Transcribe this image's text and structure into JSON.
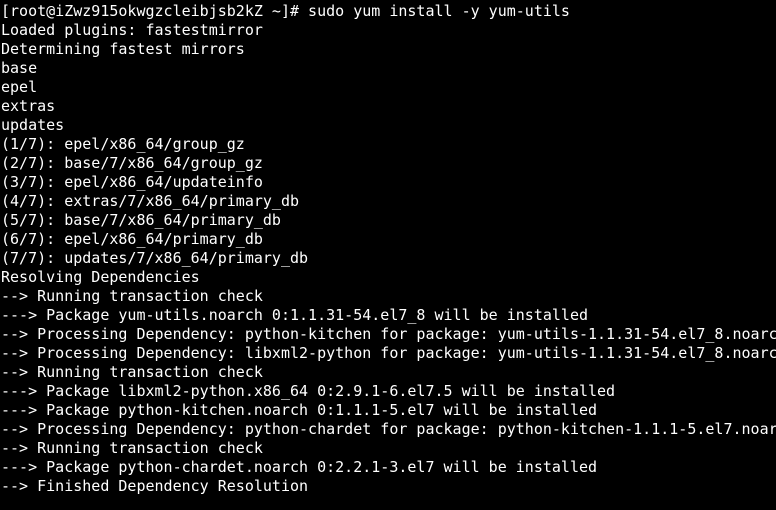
{
  "terminal": {
    "colors": {
      "background": "#000000",
      "foreground": "#ffffff"
    },
    "lines": [
      "[root@iZwz915okwgzcleibjsb2kZ ~]# sudo yum install -y yum-utils",
      "Loaded plugins: fastestmirror",
      "Determining fastest mirrors",
      "base",
      "epel",
      "extras",
      "updates",
      "(1/7): epel/x86_64/group_gz",
      "(2/7): base/7/x86_64/group_gz",
      "(3/7): epel/x86_64/updateinfo",
      "(4/7): extras/7/x86_64/primary_db",
      "(5/7): base/7/x86_64/primary_db",
      "(6/7): epel/x86_64/primary_db",
      "(7/7): updates/7/x86_64/primary_db",
      "Resolving Dependencies",
      "--> Running transaction check",
      "---> Package yum-utils.noarch 0:1.1.31-54.el7_8 will be installed",
      "--> Processing Dependency: python-kitchen for package: yum-utils-1.1.31-54.el7_8.noarc",
      "--> Processing Dependency: libxml2-python for package: yum-utils-1.1.31-54.el7_8.noarc",
      "--> Running transaction check",
      "---> Package libxml2-python.x86_64 0:2.9.1-6.el7.5 will be installed",
      "---> Package python-kitchen.noarch 0:1.1.1-5.el7 will be installed",
      "--> Processing Dependency: python-chardet for package: python-kitchen-1.1.1-5.el7.noar",
      "--> Running transaction check",
      "---> Package python-chardet.noarch 0:2.2.1-3.el7 will be installed",
      "--> Finished Dependency Resolution"
    ]
  }
}
